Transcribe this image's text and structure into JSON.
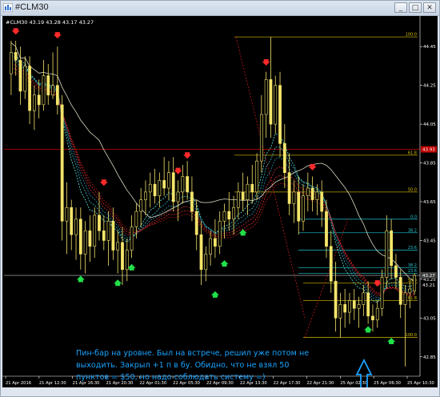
{
  "window": {
    "title": "#CLM30",
    "buttons": [
      "_",
      "□",
      "✕"
    ]
  },
  "chart_header": "#CLM30  43.19 43.28 43.17 43.27",
  "chart_data": {
    "type": "candlestick",
    "symbol": "#CLM30",
    "ohlc_header": [
      43.19,
      43.28,
      43.17,
      43.27
    ],
    "y_ticks": [
      "44.45",
      "44.25",
      "44.05",
      "43.85",
      "43.65",
      "43.45",
      "43.25",
      "43.05",
      "42.85"
    ],
    "y_tick_values": [
      44.45,
      44.25,
      44.05,
      43.85,
      43.65,
      43.45,
      43.25,
      43.05,
      42.85
    ],
    "ylim": [
      42.75,
      44.55
    ],
    "x_ticks": [
      "21 Apr 2016",
      "21 Apr 12:30",
      "21 Apr 16:30",
      "21 Apr 20:30",
      "22 Apr 01:30",
      "22 Apr 05:30",
      "22 Apr 09:30",
      "22 Apr 13:30",
      "22 Apr 17:30",
      "22 Apr 21:30",
      "25 Apr 02:30",
      "25 Apr 06:30",
      "25 Apr 10:30"
    ],
    "price_labels": [
      {
        "text": "43.93",
        "value": 43.92,
        "color": "#c00000"
      },
      {
        "text": "43.27",
        "value": 43.27,
        "color": "#404040"
      },
      {
        "text": "43.21",
        "value": 43.22,
        "color": "#000000"
      }
    ],
    "horizontal_lines": [
      {
        "value": 43.92,
        "color": "#b00000"
      },
      {
        "value": 43.27,
        "color": "#8a8a8a"
      }
    ],
    "fib_top": [
      {
        "label": "100.0",
        "value": 44.5
      },
      {
        "label": "61.8",
        "value": 43.89
      },
      {
        "label": "50.0",
        "value": 43.7
      }
    ],
    "fib_bottom": [
      {
        "label": "0.0",
        "value": 43.56
      },
      {
        "label": "38.2",
        "value": 43.49
      },
      {
        "label": "23.6",
        "value": 43.4
      },
      {
        "label": "38.2",
        "value": 43.31
      },
      {
        "label": "23.6",
        "value": 43.28
      },
      {
        "label": "50.0",
        "value": 43.23
      },
      {
        "label": "61.8",
        "value": 43.14
      },
      {
        "label": "100.0",
        "value": 42.95
      }
    ],
    "candles": [
      {
        "o": 44.31,
        "h": 44.48,
        "l": 44.2,
        "c": 44.42
      },
      {
        "o": 44.42,
        "h": 44.48,
        "l": 44.3,
        "c": 44.38
      },
      {
        "o": 44.38,
        "h": 44.45,
        "l": 44.15,
        "c": 44.22
      },
      {
        "o": 44.22,
        "h": 44.4,
        "l": 44.18,
        "c": 44.35
      },
      {
        "o": 44.35,
        "h": 44.4,
        "l": 44.05,
        "c": 44.12
      },
      {
        "o": 44.12,
        "h": 44.25,
        "l": 44.02,
        "c": 44.2
      },
      {
        "o": 44.2,
        "h": 44.28,
        "l": 44.08,
        "c": 44.15
      },
      {
        "o": 44.15,
        "h": 44.38,
        "l": 44.12,
        "c": 44.3
      },
      {
        "o": 44.3,
        "h": 44.36,
        "l": 44.15,
        "c": 44.2
      },
      {
        "o": 44.2,
        "h": 44.42,
        "l": 44.18,
        "c": 44.25
      },
      {
        "o": 44.25,
        "h": 44.45,
        "l": 44.1,
        "c": 44.15
      },
      {
        "o": 44.15,
        "h": 44.2,
        "l": 43.45,
        "c": 43.55
      },
      {
        "o": 43.55,
        "h": 43.75,
        "l": 43.38,
        "c": 43.62
      },
      {
        "o": 43.62,
        "h": 43.66,
        "l": 43.4,
        "c": 43.48
      },
      {
        "o": 43.48,
        "h": 43.62,
        "l": 43.35,
        "c": 43.56
      },
      {
        "o": 43.56,
        "h": 43.62,
        "l": 43.3,
        "c": 43.38
      },
      {
        "o": 43.38,
        "h": 43.55,
        "l": 43.28,
        "c": 43.5
      },
      {
        "o": 43.5,
        "h": 43.58,
        "l": 43.34,
        "c": 43.42
      },
      {
        "o": 43.42,
        "h": 43.62,
        "l": 43.36,
        "c": 43.58
      },
      {
        "o": 43.58,
        "h": 43.7,
        "l": 43.45,
        "c": 43.5
      },
      {
        "o": 43.5,
        "h": 43.58,
        "l": 43.4,
        "c": 43.45
      },
      {
        "o": 43.45,
        "h": 43.6,
        "l": 43.32,
        "c": 43.55
      },
      {
        "o": 43.55,
        "h": 43.62,
        "l": 43.35,
        "c": 43.4
      },
      {
        "o": 43.4,
        "h": 43.5,
        "l": 43.28,
        "c": 43.44
      },
      {
        "o": 43.44,
        "h": 43.52,
        "l": 43.22,
        "c": 43.3
      },
      {
        "o": 43.3,
        "h": 43.46,
        "l": 43.24,
        "c": 43.4
      },
      {
        "o": 43.4,
        "h": 43.58,
        "l": 43.36,
        "c": 43.52
      },
      {
        "o": 43.52,
        "h": 43.64,
        "l": 43.46,
        "c": 43.6
      },
      {
        "o": 43.6,
        "h": 43.72,
        "l": 43.52,
        "c": 43.66
      },
      {
        "o": 43.66,
        "h": 43.76,
        "l": 43.58,
        "c": 43.7
      },
      {
        "o": 43.7,
        "h": 43.8,
        "l": 43.62,
        "c": 43.74
      },
      {
        "o": 43.74,
        "h": 43.82,
        "l": 43.64,
        "c": 43.68
      },
      {
        "o": 43.68,
        "h": 43.8,
        "l": 43.62,
        "c": 43.76
      },
      {
        "o": 43.76,
        "h": 43.88,
        "l": 43.68,
        "c": 43.72
      },
      {
        "o": 43.72,
        "h": 43.86,
        "l": 43.66,
        "c": 43.8
      },
      {
        "o": 43.8,
        "h": 43.88,
        "l": 43.6,
        "c": 43.65
      },
      {
        "o": 43.65,
        "h": 43.76,
        "l": 43.55,
        "c": 43.7
      },
      {
        "o": 43.7,
        "h": 43.84,
        "l": 43.64,
        "c": 43.78
      },
      {
        "o": 43.78,
        "h": 43.86,
        "l": 43.66,
        "c": 43.7
      },
      {
        "o": 43.7,
        "h": 43.78,
        "l": 43.55,
        "c": 43.6
      },
      {
        "o": 43.6,
        "h": 43.66,
        "l": 43.4,
        "c": 43.48
      },
      {
        "o": 43.48,
        "h": 43.55,
        "l": 43.22,
        "c": 43.3
      },
      {
        "o": 43.3,
        "h": 43.42,
        "l": 43.24,
        "c": 43.38
      },
      {
        "o": 43.38,
        "h": 43.5,
        "l": 43.32,
        "c": 43.46
      },
      {
        "o": 43.46,
        "h": 43.56,
        "l": 43.36,
        "c": 43.42
      },
      {
        "o": 43.42,
        "h": 43.6,
        "l": 43.38,
        "c": 43.55
      },
      {
        "o": 43.55,
        "h": 43.64,
        "l": 43.46,
        "c": 43.6
      },
      {
        "o": 43.6,
        "h": 43.7,
        "l": 43.5,
        "c": 43.56
      },
      {
        "o": 43.56,
        "h": 43.68,
        "l": 43.48,
        "c": 43.62
      },
      {
        "o": 43.62,
        "h": 43.75,
        "l": 43.56,
        "c": 43.7
      },
      {
        "o": 43.7,
        "h": 43.8,
        "l": 43.6,
        "c": 43.66
      },
      {
        "o": 43.66,
        "h": 43.78,
        "l": 43.58,
        "c": 43.74
      },
      {
        "o": 43.74,
        "h": 43.84,
        "l": 43.64,
        "c": 43.7
      },
      {
        "o": 43.7,
        "h": 43.9,
        "l": 43.66,
        "c": 43.86
      },
      {
        "o": 43.86,
        "h": 44.2,
        "l": 43.8,
        "c": 44.1
      },
      {
        "o": 44.1,
        "h": 44.32,
        "l": 43.98,
        "c": 44.28
      },
      {
        "o": 44.28,
        "h": 44.5,
        "l": 43.98,
        "c": 44.05
      },
      {
        "o": 44.05,
        "h": 44.3,
        "l": 44.0,
        "c": 44.25
      },
      {
        "o": 44.25,
        "h": 44.32,
        "l": 43.88,
        "c": 43.95
      },
      {
        "o": 43.95,
        "h": 44.05,
        "l": 43.72,
        "c": 43.8
      },
      {
        "o": 43.8,
        "h": 43.9,
        "l": 43.58,
        "c": 43.64
      },
      {
        "o": 43.64,
        "h": 43.76,
        "l": 43.54,
        "c": 43.7
      },
      {
        "o": 43.7,
        "h": 43.78,
        "l": 43.48,
        "c": 43.55
      },
      {
        "o": 43.55,
        "h": 43.74,
        "l": 43.5,
        "c": 43.68
      },
      {
        "o": 43.68,
        "h": 43.8,
        "l": 43.6,
        "c": 43.72
      },
      {
        "o": 43.72,
        "h": 43.78,
        "l": 43.6,
        "c": 43.66
      },
      {
        "o": 43.66,
        "h": 43.74,
        "l": 43.58,
        "c": 43.7
      },
      {
        "o": 43.7,
        "h": 43.76,
        "l": 43.52,
        "c": 43.6
      },
      {
        "o": 43.6,
        "h": 43.66,
        "l": 43.36,
        "c": 43.42
      },
      {
        "o": 43.42,
        "h": 43.5,
        "l": 43.18,
        "c": 43.24
      },
      {
        "o": 43.24,
        "h": 43.34,
        "l": 42.98,
        "c": 43.05
      },
      {
        "o": 43.05,
        "h": 43.18,
        "l": 42.95,
        "c": 43.12
      },
      {
        "o": 43.12,
        "h": 43.2,
        "l": 43.0,
        "c": 43.08
      },
      {
        "o": 43.08,
        "h": 43.18,
        "l": 43.02,
        "c": 43.14
      },
      {
        "o": 43.14,
        "h": 43.2,
        "l": 43.04,
        "c": 43.1
      },
      {
        "o": 43.1,
        "h": 43.16,
        "l": 43.0,
        "c": 43.12
      },
      {
        "o": 43.12,
        "h": 43.22,
        "l": 43.06,
        "c": 43.18
      },
      {
        "o": 43.18,
        "h": 43.24,
        "l": 43.02,
        "c": 43.06
      },
      {
        "o": 43.06,
        "h": 43.12,
        "l": 42.98,
        "c": 43.04
      },
      {
        "o": 43.04,
        "h": 43.14,
        "l": 43.0,
        "c": 43.1
      },
      {
        "o": 43.1,
        "h": 43.3,
        "l": 43.06,
        "c": 43.26
      },
      {
        "o": 43.26,
        "h": 43.58,
        "l": 43.2,
        "c": 43.5
      },
      {
        "o": 43.5,
        "h": 43.56,
        "l": 43.25,
        "c": 43.32
      },
      {
        "o": 43.32,
        "h": 43.38,
        "l": 43.2,
        "c": 43.26
      },
      {
        "o": 43.26,
        "h": 43.3,
        "l": 43.05,
        "c": 43.12
      },
      {
        "o": 43.12,
        "h": 43.22,
        "l": 42.8,
        "c": 43.18
      },
      {
        "o": 43.18,
        "h": 43.24,
        "l": 43.1,
        "c": 43.2
      },
      {
        "o": 43.19,
        "h": 43.28,
        "l": 43.17,
        "c": 43.27
      }
    ],
    "signals_down": [
      {
        "i": 1,
        "p": 44.52
      },
      {
        "i": 10,
        "p": 44.5
      },
      {
        "i": 20,
        "p": 43.74
      },
      {
        "i": 36,
        "p": 43.8
      },
      {
        "i": 38,
        "p": 43.88
      },
      {
        "i": 55,
        "p": 44.36
      },
      {
        "i": 65,
        "p": 43.82
      },
      {
        "i": 79,
        "p": 43.22
      }
    ],
    "signals_up": [
      {
        "i": 15,
        "p": 43.26
      },
      {
        "i": 23,
        "p": 43.24
      },
      {
        "i": 26,
        "p": 43.32
      },
      {
        "i": 44,
        "p": 43.18
      },
      {
        "i": 46,
        "p": 43.34
      },
      {
        "i": 50,
        "p": 43.5
      },
      {
        "i": 77,
        "p": 43.0
      },
      {
        "i": 82,
        "p": 42.94
      }
    ]
  },
  "annotation": {
    "text": "Пин-бар на уровне. Был на встрече, решил уже потом не выходить. Закрыл +1 п в бу. Обидно, что не взял 50 пунктов = $50, но надо соблюдать систему =)",
    "color": "#1aa3ff"
  }
}
